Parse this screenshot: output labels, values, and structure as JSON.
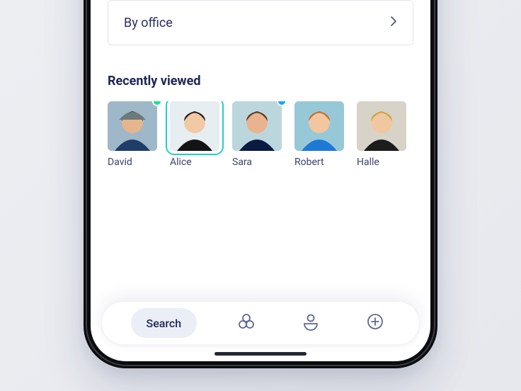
{
  "filters": {
    "by_office_label": "By office"
  },
  "recent": {
    "title": "Recently viewed",
    "people": [
      {
        "name": "David",
        "selected": false,
        "status_color": "#19e28f"
      },
      {
        "name": "Alice",
        "selected": true,
        "status_color": ""
      },
      {
        "name": "Sara",
        "selected": false,
        "status_color": "#16a7ff"
      },
      {
        "name": "Robert",
        "selected": false,
        "status_color": ""
      },
      {
        "name": "Halle",
        "selected": false,
        "status_color": ""
      }
    ]
  },
  "nav": {
    "search_label": "Search"
  },
  "colors": {
    "accent": "#21cfc6",
    "text": "#1e2654"
  },
  "avatar_palettes": [
    {
      "bg": "#9fb8c9",
      "shirt": "#1f3d66",
      "skin": "#e7b58d",
      "hair": "#2e2b28",
      "hat": "#6d7a7a"
    },
    {
      "bg": "#e6eef2",
      "shirt": "#141414",
      "skin": "#f2c9a5",
      "hair": "#2a1d17",
      "hat": ""
    },
    {
      "bg": "#bcd6de",
      "shirt": "#0a1a40",
      "skin": "#e8b38e",
      "hair": "#5a3a22",
      "hat": ""
    },
    {
      "bg": "#97c8d7",
      "shirt": "#1e78d6",
      "skin": "#f1c6a0",
      "hair": "#c86a2a",
      "hat": ""
    },
    {
      "bg": "#d7d3c8",
      "shirt": "#1c1c1c",
      "skin": "#f0c7a0",
      "hair": "#caa341",
      "hat": ""
    }
  ]
}
